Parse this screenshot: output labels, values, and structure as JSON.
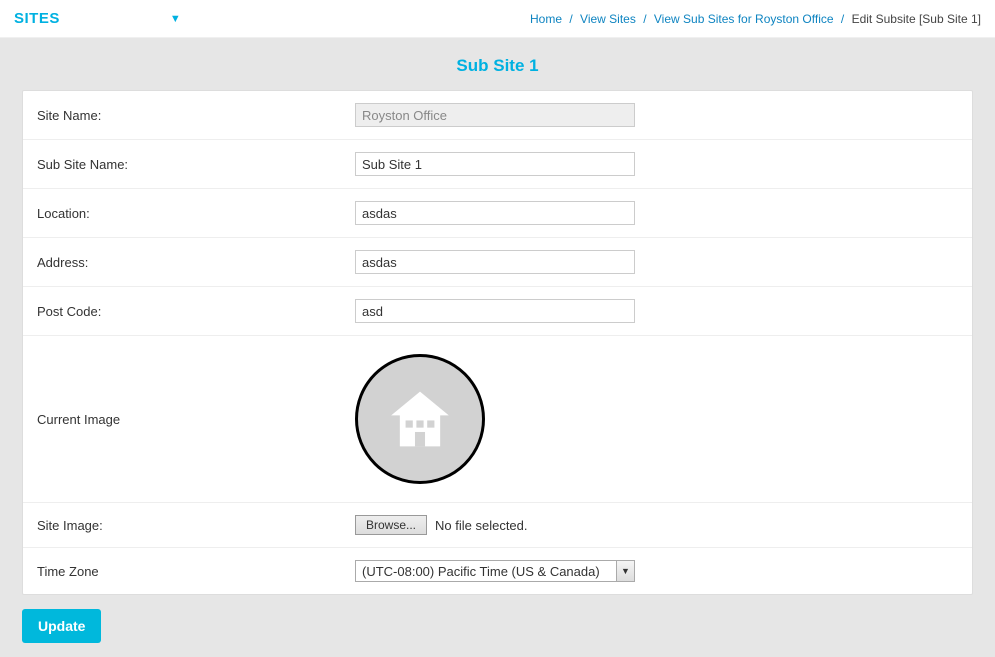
{
  "topbar": {
    "sites_label": "SITES"
  },
  "breadcrumb": {
    "home": "Home",
    "view_sites": "View Sites",
    "view_sub_sites": "View Sub Sites for Royston Office",
    "current": "Edit Subsite [Sub Site 1]"
  },
  "page_title": "Sub Site 1",
  "form": {
    "site_name": {
      "label": "Site Name:",
      "value": "Royston Office"
    },
    "sub_site_name": {
      "label": "Sub Site Name:",
      "value": "Sub Site 1"
    },
    "location": {
      "label": "Location:",
      "value": "asdas"
    },
    "address": {
      "label": "Address:",
      "value": "asdas"
    },
    "post_code": {
      "label": "Post Code:",
      "value": "asd"
    },
    "current_image": {
      "label": "Current Image"
    },
    "site_image": {
      "label": "Site Image:",
      "browse_label": "Browse...",
      "no_file": "No file selected."
    },
    "time_zone": {
      "label": "Time Zone",
      "selected": "(UTC-08:00) Pacific Time (US & Canada)"
    }
  },
  "actions": {
    "update": "Update"
  }
}
